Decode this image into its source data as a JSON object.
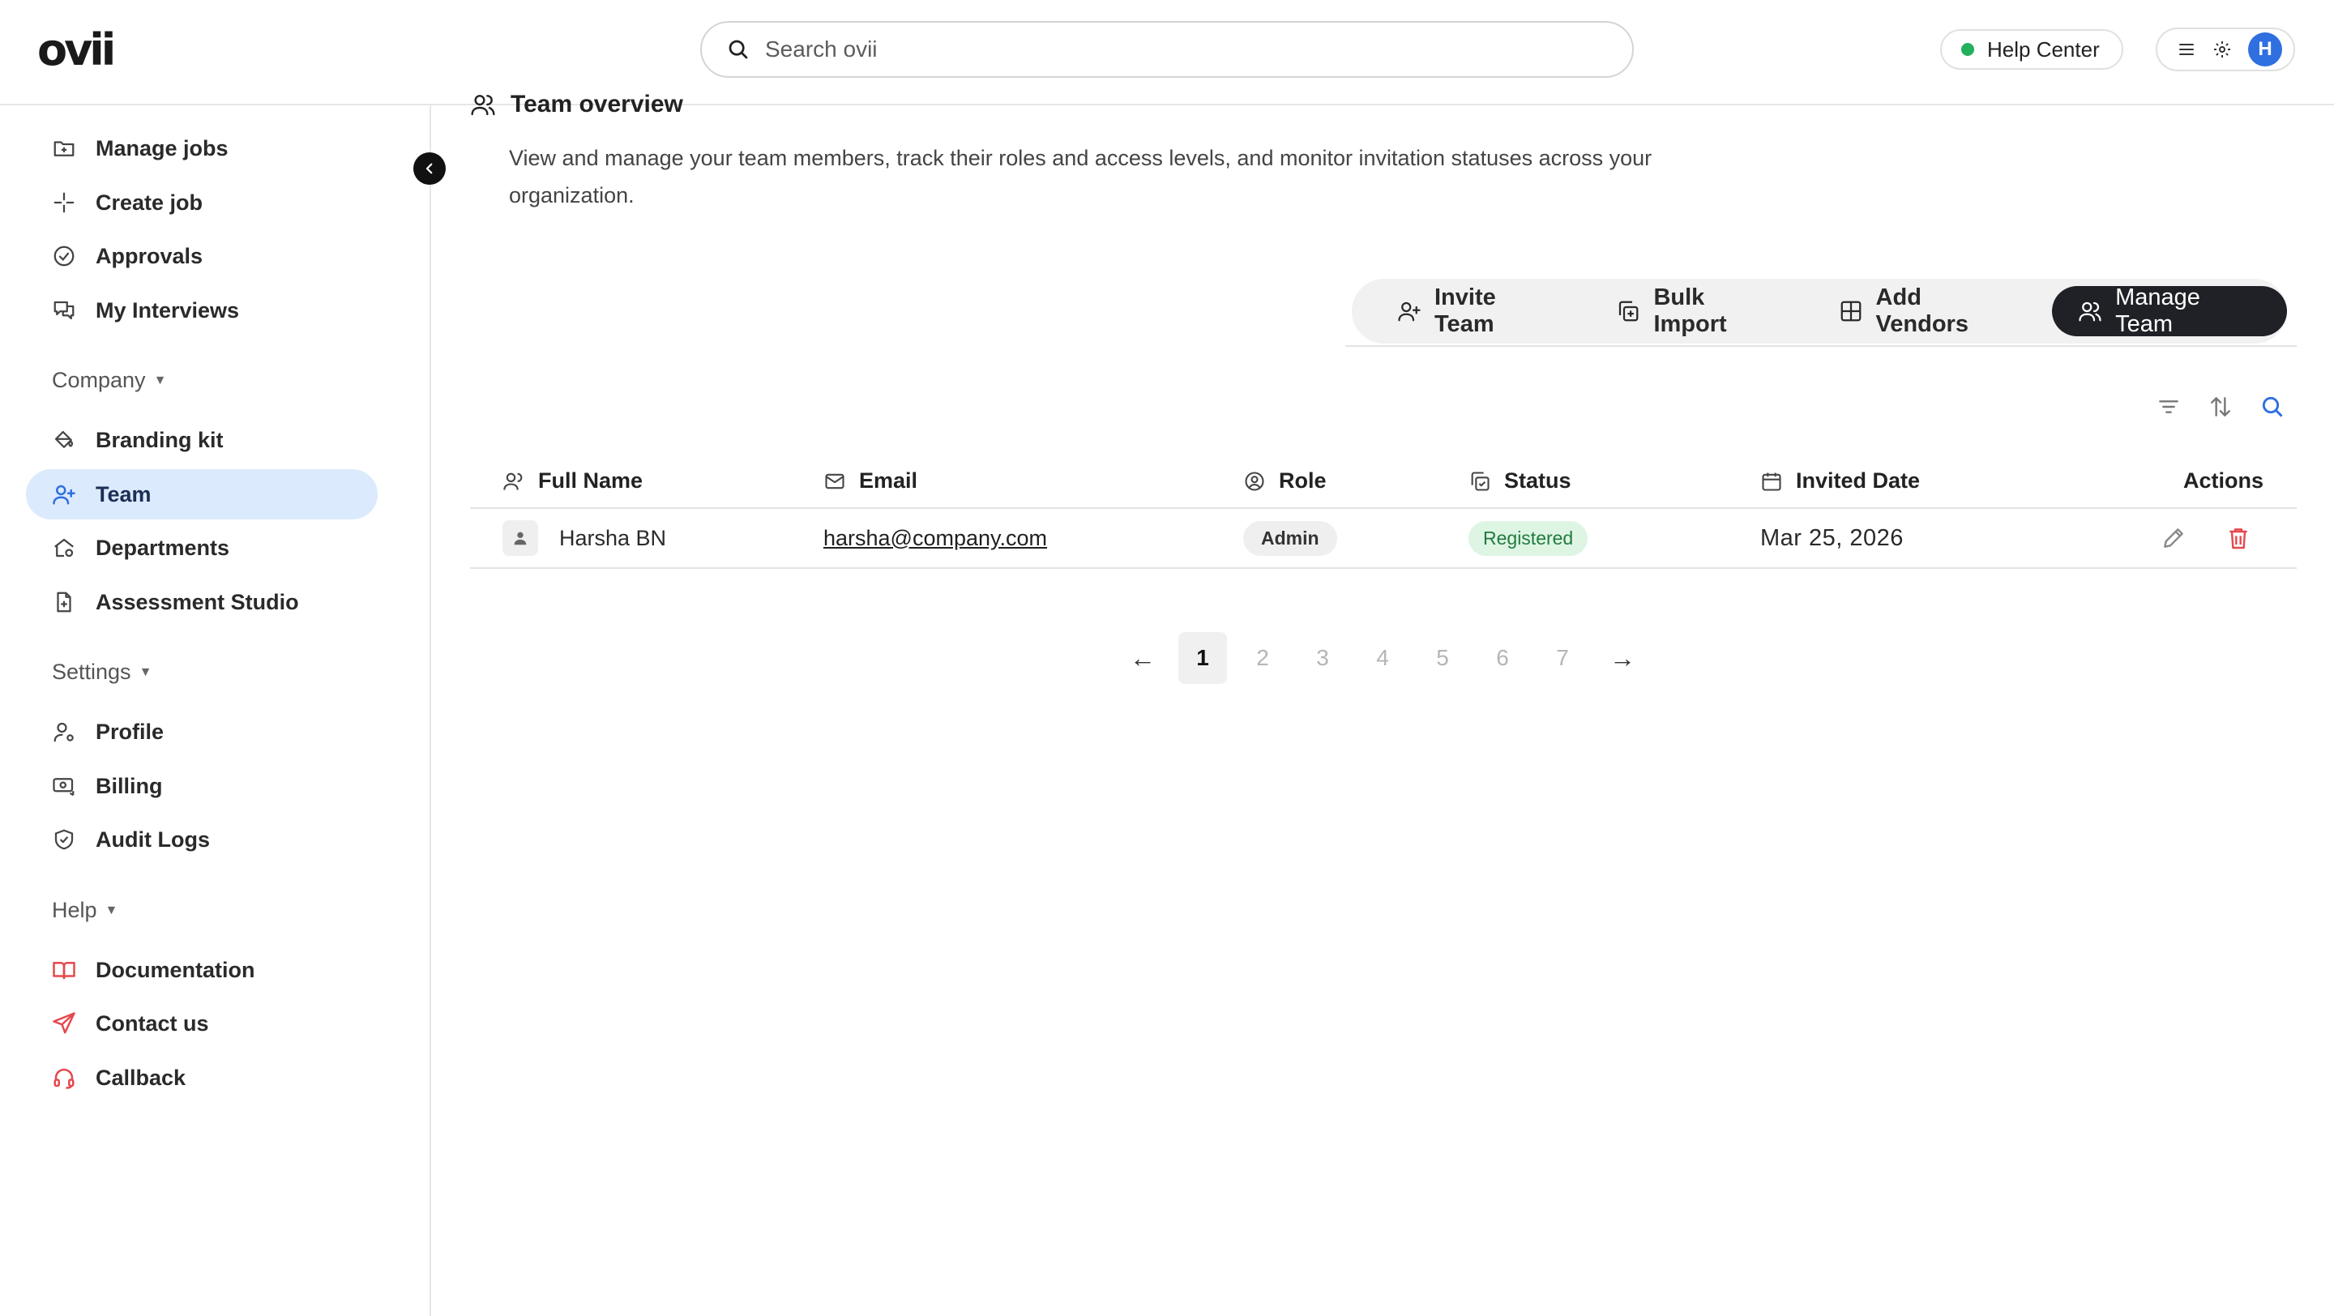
{
  "app": {
    "logo_text": "ovii"
  },
  "header": {
    "search_placeholder": "Search ovii",
    "help_center_label": "Help Center",
    "avatar_initial": "H"
  },
  "sidebar": {
    "main_items": [
      {
        "label": "Manage jobs",
        "icon": "folder-plus-icon"
      },
      {
        "label": "Create job",
        "icon": "sparkle-plus-icon"
      },
      {
        "label": "Approvals",
        "icon": "check-circle-icon"
      },
      {
        "label": "My Interviews",
        "icon": "chat-bubbles-icon"
      }
    ],
    "company_label": "Company",
    "company_items": [
      {
        "label": "Branding kit",
        "icon": "paint-bucket-icon"
      },
      {
        "label": "Team",
        "icon": "user-plus-icon",
        "active": true
      },
      {
        "label": "Departments",
        "icon": "home-gear-icon"
      },
      {
        "label": "Assessment Studio",
        "icon": "file-plus-icon"
      }
    ],
    "settings_label": "Settings",
    "settings_items": [
      {
        "label": "Profile",
        "icon": "user-gear-icon"
      },
      {
        "label": "Billing",
        "icon": "billing-card-icon"
      },
      {
        "label": "Audit Logs",
        "icon": "shield-check-icon"
      }
    ],
    "help_label": "Help",
    "help_items": [
      {
        "label": "Documentation",
        "icon": "book-open-icon"
      },
      {
        "label": "Contact us",
        "icon": "send-icon"
      },
      {
        "label": "Callback",
        "icon": "headset-icon"
      }
    ]
  },
  "main": {
    "title": "Team overview",
    "description": "View and manage your team members, track their roles and access levels, and monitor invitation statuses across your organization.",
    "tabs": [
      {
        "label": "Invite Team",
        "icon": "user-plus-icon"
      },
      {
        "label": "Bulk Import",
        "icon": "copy-plus-icon"
      },
      {
        "label": "Add Vendors",
        "icon": "grid-plus-icon"
      },
      {
        "label": "Manage Team",
        "icon": "users-icon",
        "active": true
      }
    ],
    "table": {
      "columns": [
        "Full Name",
        "Email",
        "Role",
        "Status",
        "Invited Date",
        "Actions"
      ],
      "rows": [
        {
          "name": "Harsha BN",
          "email": "harsha@company.com",
          "role": "Admin",
          "status": "Registered",
          "invited_date": "Mar 25, 2026"
        }
      ]
    },
    "pagination": {
      "prev": "←",
      "next": "→",
      "pages": [
        "1",
        "2",
        "3",
        "4",
        "5",
        "6",
        "7"
      ],
      "current": "1"
    }
  },
  "colors": {
    "accent": "#2f6fe0",
    "active_nav_bg": "#dbeafc",
    "status_green": "#22b05a",
    "danger": "#e5484d"
  }
}
